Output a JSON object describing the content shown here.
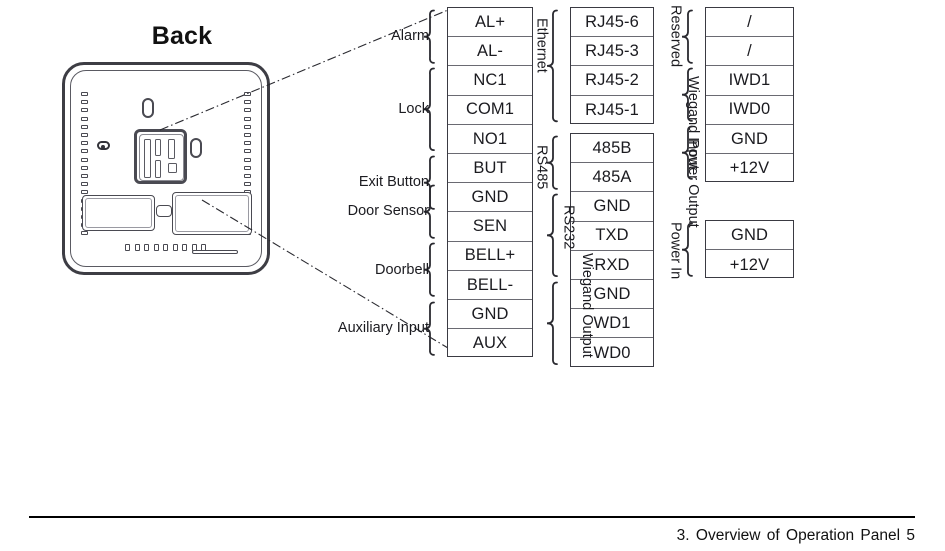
{
  "device": {
    "title": "Back",
    "view_label": "device-back-panel"
  },
  "terminals": {
    "column1": {
      "name": "main-terminal-strip",
      "rows": [
        "AL+",
        "AL-",
        "NC1",
        "COM1",
        "NO1",
        "BUT",
        "GND",
        "SEN",
        "BELL+",
        "BELL-",
        "GND",
        "AUX"
      ],
      "groups": [
        {
          "label": "Alarm",
          "from": 0,
          "to": 1
        },
        {
          "label": "Lock",
          "from": 2,
          "to": 4
        },
        {
          "label": "Exit Button",
          "from": 5,
          "to": 6
        },
        {
          "label": "Door Sensor",
          "from": 6,
          "to": 7
        },
        {
          "label": "Doorbell",
          "from": 8,
          "to": 9
        },
        {
          "label": "Auxiliary Input",
          "from": 10,
          "to": 11
        }
      ]
    },
    "column2_top": {
      "name": "ethernet-terminal-strip",
      "rows": [
        "RJ45-6",
        "RJ45-3",
        "RJ45-2",
        "RJ45-1"
      ],
      "groups": [
        {
          "label": "Ethernet",
          "from": 0,
          "to": 3
        }
      ]
    },
    "column2_bottom": {
      "name": "serial-wiegand-terminal-strip",
      "rows": [
        "485B",
        "485A",
        "GND",
        "TXD",
        "RXD",
        "GND",
        "WD1",
        "WD0"
      ],
      "groups": [
        {
          "label": "RS485",
          "from": 0,
          "to": 1
        },
        {
          "label": "RS232",
          "from": 2,
          "to": 4
        },
        {
          "label": "Wiegand Output",
          "from": 5,
          "to": 7
        }
      ]
    },
    "column3_top": {
      "name": "reserved-wiegand-power-terminal-strip",
      "rows": [
        "/",
        "/",
        "IWD1",
        "IWD0",
        "GND",
        "+12V"
      ],
      "groups": [
        {
          "label": "Reserved",
          "from": 0,
          "to": 1
        },
        {
          "label": "Wiegand Input",
          "from": 2,
          "to": 3
        },
        {
          "label": "Power Output",
          "from": 4,
          "to": 5
        }
      ]
    },
    "column3_bottom": {
      "name": "power-in-terminal-strip",
      "rows": [
        "GND",
        "+12V"
      ],
      "groups": [
        {
          "label": "Power In",
          "from": 0,
          "to": 1
        }
      ]
    }
  },
  "footer": {
    "text": "3. Overview of Operation Panel   5"
  },
  "colors": {
    "outline": "#3a3a42",
    "divider": "#6a6a72",
    "text": "#1b1b20"
  }
}
